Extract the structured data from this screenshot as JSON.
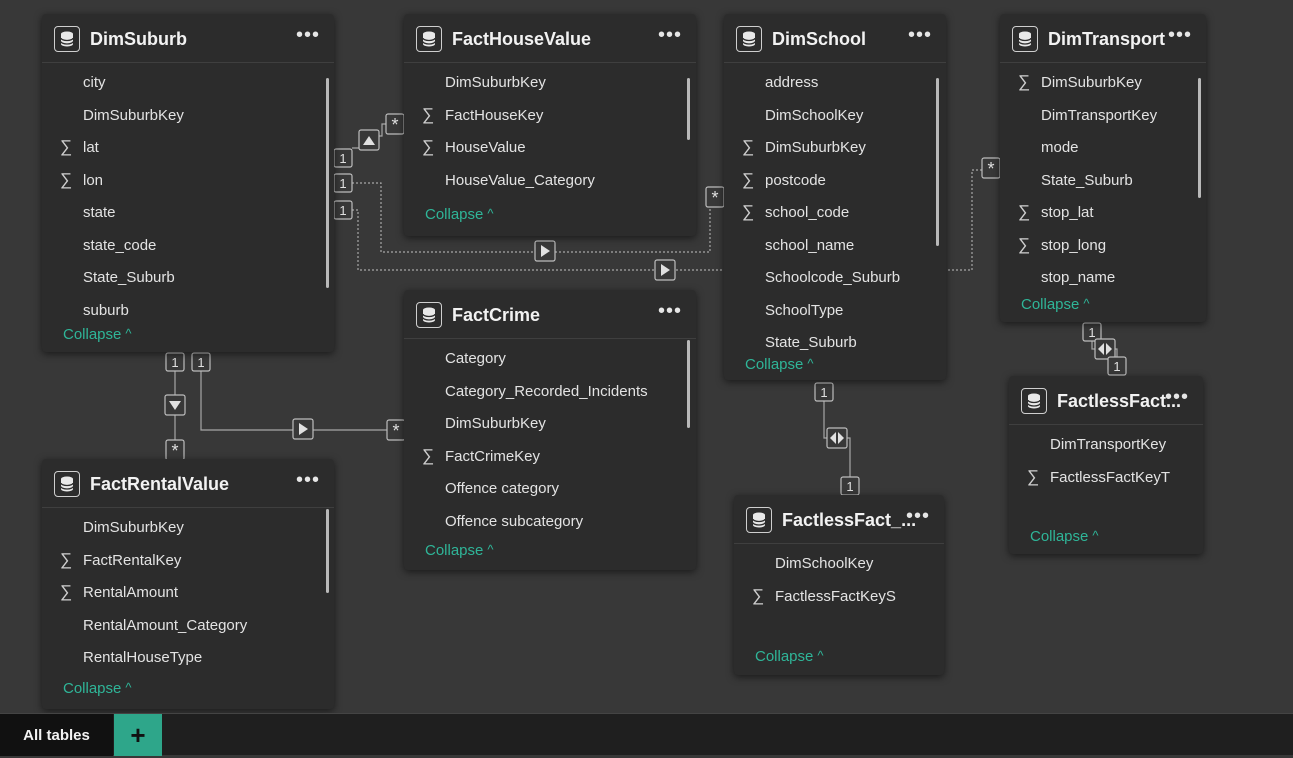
{
  "ui": {
    "more_glyph": "•••",
    "sigma_glyph": "∑",
    "collapse_label": "Collapse",
    "collapse_chevron": "^",
    "accent_color": "#2fb598"
  },
  "tables": {
    "dim_suburb": {
      "title": "DimSuburb",
      "fields": [
        {
          "name": "city",
          "sum": false
        },
        {
          "name": "DimSuburbKey",
          "sum": false
        },
        {
          "name": "lat",
          "sum": true
        },
        {
          "name": "lon",
          "sum": true
        },
        {
          "name": "state",
          "sum": false
        },
        {
          "name": "state_code",
          "sum": false
        },
        {
          "name": "State_Suburb",
          "sum": false
        },
        {
          "name": "suburb",
          "sum": false
        }
      ]
    },
    "fact_house_value": {
      "title": "FactHouseValue",
      "fields": [
        {
          "name": "DimSuburbKey",
          "sum": false
        },
        {
          "name": "FactHouseKey",
          "sum": true
        },
        {
          "name": "HouseValue",
          "sum": true
        },
        {
          "name": "HouseValue_Category",
          "sum": false
        }
      ]
    },
    "dim_school": {
      "title": "DimSchool",
      "fields": [
        {
          "name": "address",
          "sum": false
        },
        {
          "name": "DimSchoolKey",
          "sum": false
        },
        {
          "name": "DimSuburbKey",
          "sum": true
        },
        {
          "name": "postcode",
          "sum": true
        },
        {
          "name": "school_code",
          "sum": true
        },
        {
          "name": "school_name",
          "sum": false
        },
        {
          "name": "Schoolcode_Suburb",
          "sum": false
        },
        {
          "name": "SchoolType",
          "sum": false
        },
        {
          "name": "State_Suburb",
          "sum": false
        }
      ]
    },
    "dim_transport": {
      "title": "DimTransport",
      "fields": [
        {
          "name": "DimSuburbKey",
          "sum": true
        },
        {
          "name": "DimTransportKey",
          "sum": false
        },
        {
          "name": "mode",
          "sum": false
        },
        {
          "name": "State_Suburb",
          "sum": false
        },
        {
          "name": "stop_lat",
          "sum": true
        },
        {
          "name": "stop_long",
          "sum": true
        },
        {
          "name": "stop_name",
          "sum": false
        }
      ]
    },
    "fact_crime": {
      "title": "FactCrime",
      "fields": [
        {
          "name": "Category",
          "sum": false
        },
        {
          "name": "Category_Recorded_Incidents",
          "sum": false
        },
        {
          "name": "DimSuburbKey",
          "sum": false
        },
        {
          "name": "FactCrimeKey",
          "sum": true
        },
        {
          "name": "Offence category",
          "sum": false
        },
        {
          "name": "Offence subcategory",
          "sum": false
        }
      ]
    },
    "fact_rental_value": {
      "title": "FactRentalValue",
      "fields": [
        {
          "name": "DimSuburbKey",
          "sum": false
        },
        {
          "name": "FactRentalKey",
          "sum": true
        },
        {
          "name": "RentalAmount",
          "sum": true
        },
        {
          "name": "RentalAmount_Category",
          "sum": false
        },
        {
          "name": "RentalHouseType",
          "sum": false
        }
      ]
    },
    "factless_fact_school": {
      "title": "FactlessFact_...",
      "fields": [
        {
          "name": "DimSchoolKey",
          "sum": false
        },
        {
          "name": "FactlessFactKeyS",
          "sum": true
        }
      ]
    },
    "factless_fact_transport": {
      "title": "FactlessFact...",
      "fields": [
        {
          "name": "DimTransportKey",
          "sum": false
        },
        {
          "name": "FactlessFactKeyT",
          "sum": true
        }
      ]
    }
  },
  "relationship_labels": {
    "one": "1",
    "many": "*"
  },
  "bottom_bar": {
    "tab_label": "All tables",
    "add_label": "+"
  }
}
